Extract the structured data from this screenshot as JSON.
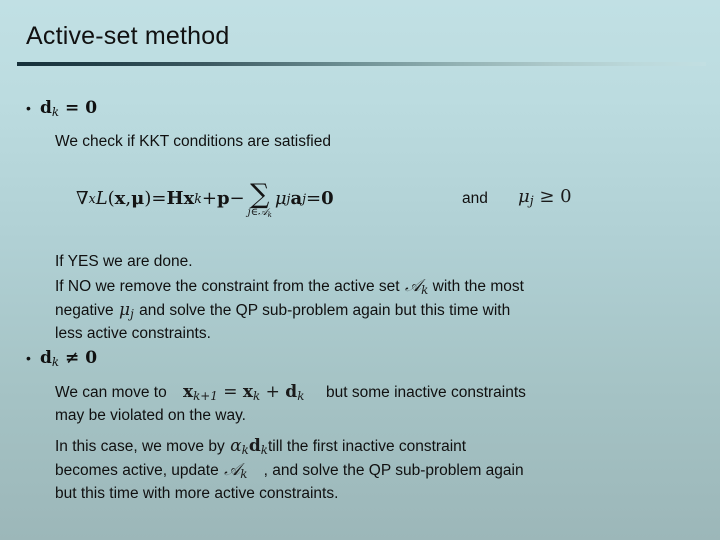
{
  "slide": {
    "title": "Active-set method",
    "background_top_color": "#c1e0e4",
    "background_bottom_color": "#9cb7b9",
    "rule_color_dark": "#16303a",
    "text_color": "#101010"
  },
  "bullets": [
    {
      "marker": "•",
      "math": "d",
      "math_sub": "k",
      "math_rel": " = 0"
    },
    {
      "marker": "•",
      "math": "d",
      "math_sub": "k",
      "math_rel": " ≠ 0"
    }
  ],
  "lines": {
    "kkt_check": "We check if KKT conditions are satisfied",
    "and_word": "and",
    "if_yes": "If YES we are done.",
    "if_no_a": "If NO we remove the constraint from the active set",
    "if_no_b": "with the most",
    "negative_a": "negative",
    "negative_b": "and solve the QP sub-problem again but this time with",
    "negative_c": "less active constraints.",
    "move_to_a": "We can move to",
    "move_to_b": "but some inactive constraints",
    "move_to_c": "may be violated on the way.",
    "case_a": "In this case, we move by",
    "case_b": "till the first inactive constraint",
    "case_c": "becomes active, update",
    "case_d": ", and solve the QP sub-problem again",
    "case_e": "but this time with more active constraints."
  },
  "equation": {
    "grad": "∇",
    "grad_sub": "x",
    "lagrangian": "L",
    "args_open": "(",
    "arg_x": "x",
    "arg_comma": ", ",
    "arg_mu": "μ",
    "args_close": ")",
    "equals": " = ",
    "hessian": "H",
    "x_var": "x",
    "x_sub": "k",
    "plus": " + ",
    "p_var": "p",
    "minus": " − ",
    "sum_glyph": "∑",
    "sum_sub": "j∈𝒜",
    "sum_sub_k": "k",
    "mu_var": "μ",
    "mu_sub": "j",
    "a_var": "a",
    "a_sub": "j",
    "equals2": " = ",
    "zero": "0",
    "condition": "μ",
    "condition_sub": "j",
    "condition_rel": " ≥ 0"
  },
  "inline_math": {
    "active_set": "𝒜",
    "active_set_sub": "k",
    "mu_j": "μ",
    "mu_j_sub": "j",
    "step_x_next": "x",
    "step_x_next_sub": "k+1",
    "step_eq": " = ",
    "step_x": "x",
    "step_x_sub": "k",
    "step_plus": " + ",
    "step_d": "d",
    "step_d_sub": "k",
    "alpha": "α",
    "alpha_sub": "k",
    "alpha_d": "d",
    "alpha_d_sub": "k"
  }
}
